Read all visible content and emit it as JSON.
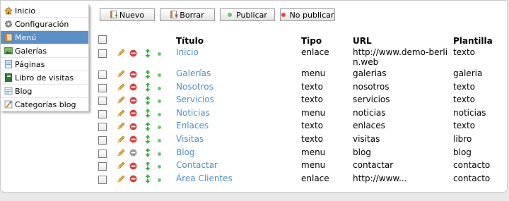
{
  "sidebar": {
    "items": [
      {
        "label": "Inicio",
        "icon": "home-icon",
        "active": false
      },
      {
        "label": "Configuración",
        "icon": "gear-icon",
        "active": false
      },
      {
        "label": "Menú",
        "icon": "menu-icon",
        "active": true
      },
      {
        "label": "Galerías",
        "icon": "gallery-icon",
        "active": false
      },
      {
        "label": "Páginas",
        "icon": "page-icon",
        "active": false
      },
      {
        "label": "Libro de visitas",
        "icon": "guestbook-icon",
        "active": false
      },
      {
        "label": "Blog",
        "icon": "blog-icon",
        "active": false
      },
      {
        "label": "Categorías blog",
        "icon": "blog-categories-icon",
        "active": false
      }
    ]
  },
  "toolbar": {
    "new_label": "Nuevo",
    "delete_label": "Borrar",
    "publish_label": "Publicar",
    "unpublish_label": "No publicar"
  },
  "table": {
    "headers": {
      "title": "Título",
      "type": "Tipo",
      "url": "URL",
      "template": "Plantilla"
    },
    "rows": [
      {
        "title": "Inicio",
        "type": "enlace",
        "url": "http://www.demo-berlin.web",
        "template": "texto",
        "published": true,
        "deletable": true
      },
      {
        "title": "Galerías",
        "type": "menu",
        "url": "galerias",
        "template": "galeria",
        "published": true,
        "deletable": true
      },
      {
        "title": "Nosotros",
        "type": "texto",
        "url": "nosotros",
        "template": "texto",
        "published": true,
        "deletable": true
      },
      {
        "title": "Servicios",
        "type": "texto",
        "url": "servicios",
        "template": "texto",
        "published": true,
        "deletable": true
      },
      {
        "title": "Noticias",
        "type": "menu",
        "url": "noticias",
        "template": "noticias",
        "published": true,
        "deletable": true
      },
      {
        "title": "Enlaces",
        "type": "texto",
        "url": "enlaces",
        "template": "texto",
        "published": true,
        "deletable": true
      },
      {
        "title": "Visitas",
        "type": "texto",
        "url": "visitas",
        "template": "libro",
        "published": true,
        "deletable": true
      },
      {
        "title": "Blog",
        "type": "menu",
        "url": "blog",
        "template": "blog",
        "published": true,
        "deletable": false
      },
      {
        "title": "Contactar",
        "type": "menu",
        "url": "contactar",
        "template": "contacto",
        "published": true,
        "deletable": true
      },
      {
        "title": "Área Clientes",
        "type": "enlace",
        "url": "http://www...",
        "template": "contacto",
        "published": true,
        "deletable": true
      }
    ]
  },
  "colors": {
    "accent": "#5b8fc7",
    "link": "#4f8fc4",
    "published_dot": "#6fc46f",
    "unpublished_dot": "#e04848",
    "delete_red": "#d94040",
    "delete_disabled": "#9a9a9a",
    "move_green": "#3fae3f"
  }
}
